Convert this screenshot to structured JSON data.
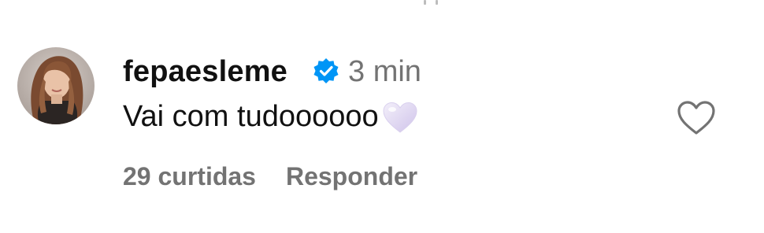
{
  "comment": {
    "username": "fepaesleme",
    "verified": true,
    "timestamp": "3 min",
    "text": "Vai com tudoooooo",
    "emoji": "white-heart-emoji",
    "likes_label": "29 curtidas",
    "reply_label": "Responder"
  },
  "icons": {
    "verified": "verified-badge-icon",
    "like": "heart-outline-icon"
  },
  "colors": {
    "verified_blue": "#0095f6",
    "text_primary": "#111111",
    "text_secondary": "#737373",
    "emoji_heart": "#e4ddf3"
  }
}
